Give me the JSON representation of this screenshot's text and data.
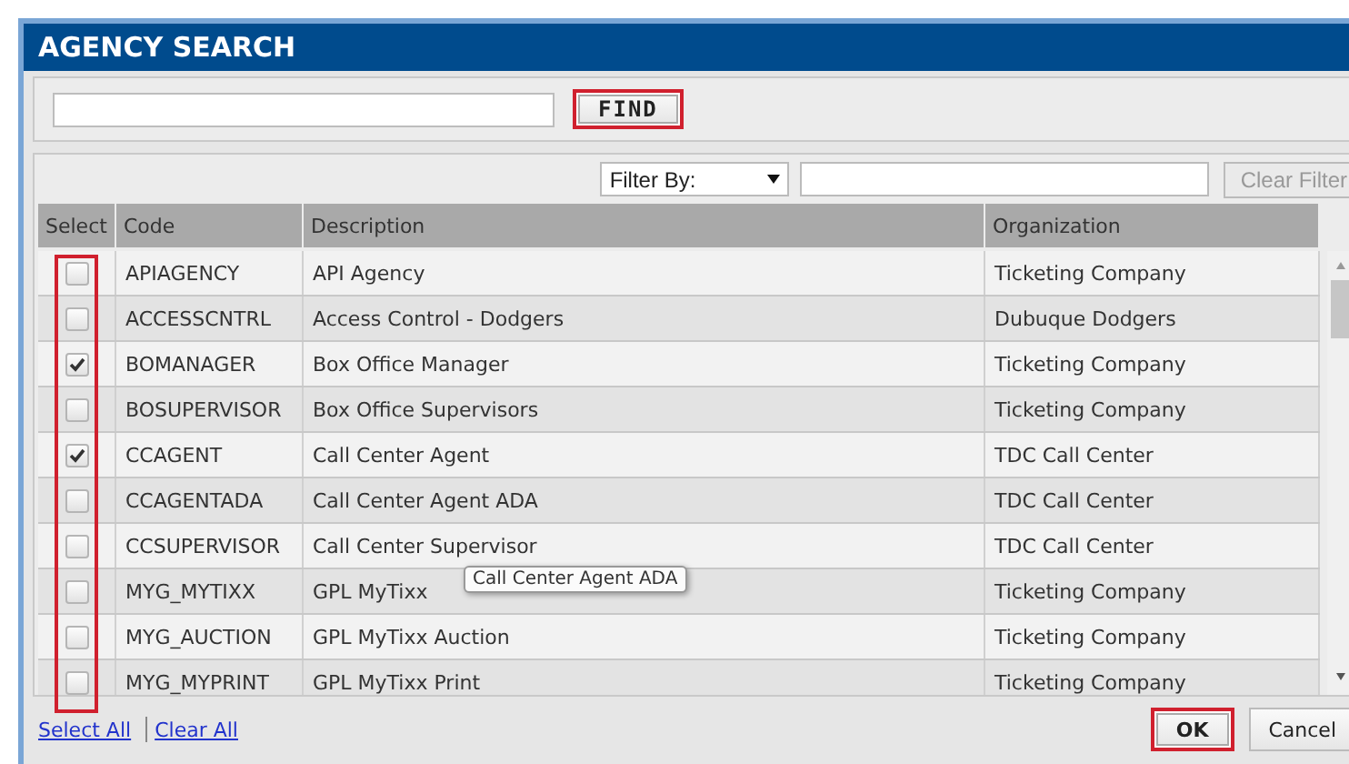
{
  "window": {
    "title": "AGENCY SEARCH"
  },
  "search": {
    "find_button": {
      "label": "FIND",
      "highlighted": true
    }
  },
  "filter": {
    "select_label": "Filter By:",
    "clear_button": {
      "label": "Clear Filter",
      "disabled": true
    }
  },
  "table": {
    "columns": [
      "Select",
      "Code",
      "Description",
      "Organization"
    ],
    "select_column_highlighted": true,
    "rows": [
      {
        "checked": false,
        "code": "APIAGENCY",
        "description": "API Agency",
        "organization": "Ticketing Company"
      },
      {
        "checked": false,
        "code": "ACCESSCNTRL",
        "description": "Access Control - Dodgers",
        "organization": "Dubuque Dodgers"
      },
      {
        "checked": true,
        "code": "BOMANAGER",
        "description": "Box Office Manager",
        "organization": "Ticketing Company"
      },
      {
        "checked": false,
        "code": "BOSUPERVISOR",
        "description": "Box Office Supervisors",
        "organization": "Ticketing Company"
      },
      {
        "checked": true,
        "code": "CCAGENT",
        "description": "Call Center Agent",
        "organization": "TDC Call Center"
      },
      {
        "checked": false,
        "code": "CCAGENTADA",
        "description": "Call Center Agent ADA",
        "organization": "TDC Call Center"
      },
      {
        "checked": false,
        "code": "CCSUPERVISOR",
        "description": "Call Center Supervisor",
        "organization": "TDC Call Center"
      },
      {
        "checked": false,
        "code": "MYG_MYTIXX",
        "description": "GPL MyTixx",
        "organization": "Ticketing Company"
      },
      {
        "checked": false,
        "code": "MYG_AUCTION",
        "description": "GPL MyTixx Auction",
        "organization": "Ticketing Company"
      },
      {
        "checked": false,
        "code": "MYG_MYPRINT",
        "description": "GPL MyTixx Print",
        "organization": "Ticketing Company"
      }
    ]
  },
  "tooltip": {
    "text": "Call Center Agent ADA"
  },
  "footer": {
    "links": [
      "Select All",
      "Clear All"
    ],
    "buttons": [
      {
        "label": "OK",
        "highlighted": true
      },
      {
        "label": "Cancel",
        "highlighted": false
      }
    ]
  }
}
